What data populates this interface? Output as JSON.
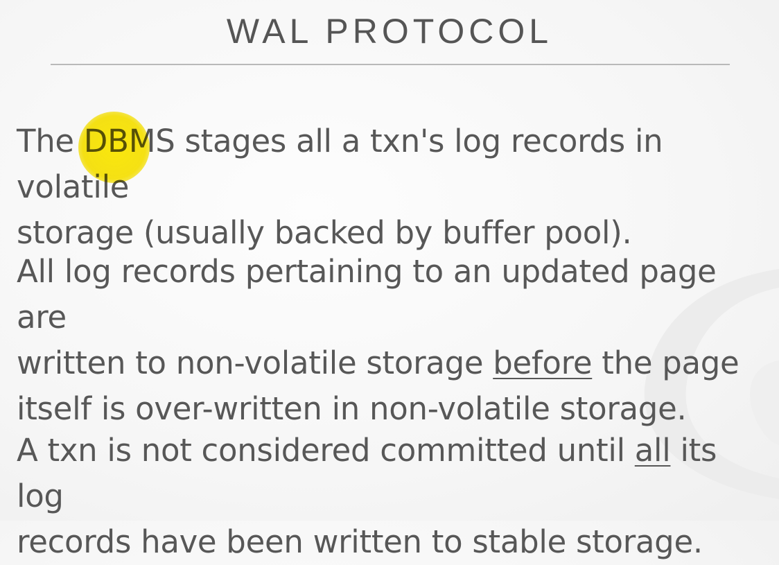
{
  "slide": {
    "title": "WAL PROTOCOL",
    "para1": {
      "line1": "The DBMS stages all a txn's log records in volatile",
      "line2": "storage (usually backed by buffer pool)."
    },
    "para2": {
      "line1": "All log records pertaining to an updated page are",
      "line2_pre": "written to non-volatile storage ",
      "line2_under": "before",
      "line2_post": " the page",
      "line3": "itself is over-written in non-volatile storage."
    },
    "para3": {
      "line1_pre": "A txn is not considered committed until ",
      "line1_under": "all",
      "line1_post": " its log",
      "line2": "records have been written to stable storage."
    }
  },
  "colors": {
    "text": "#575757",
    "rule": "#b9b9b9",
    "cursor_highlight": "#f7e400"
  }
}
